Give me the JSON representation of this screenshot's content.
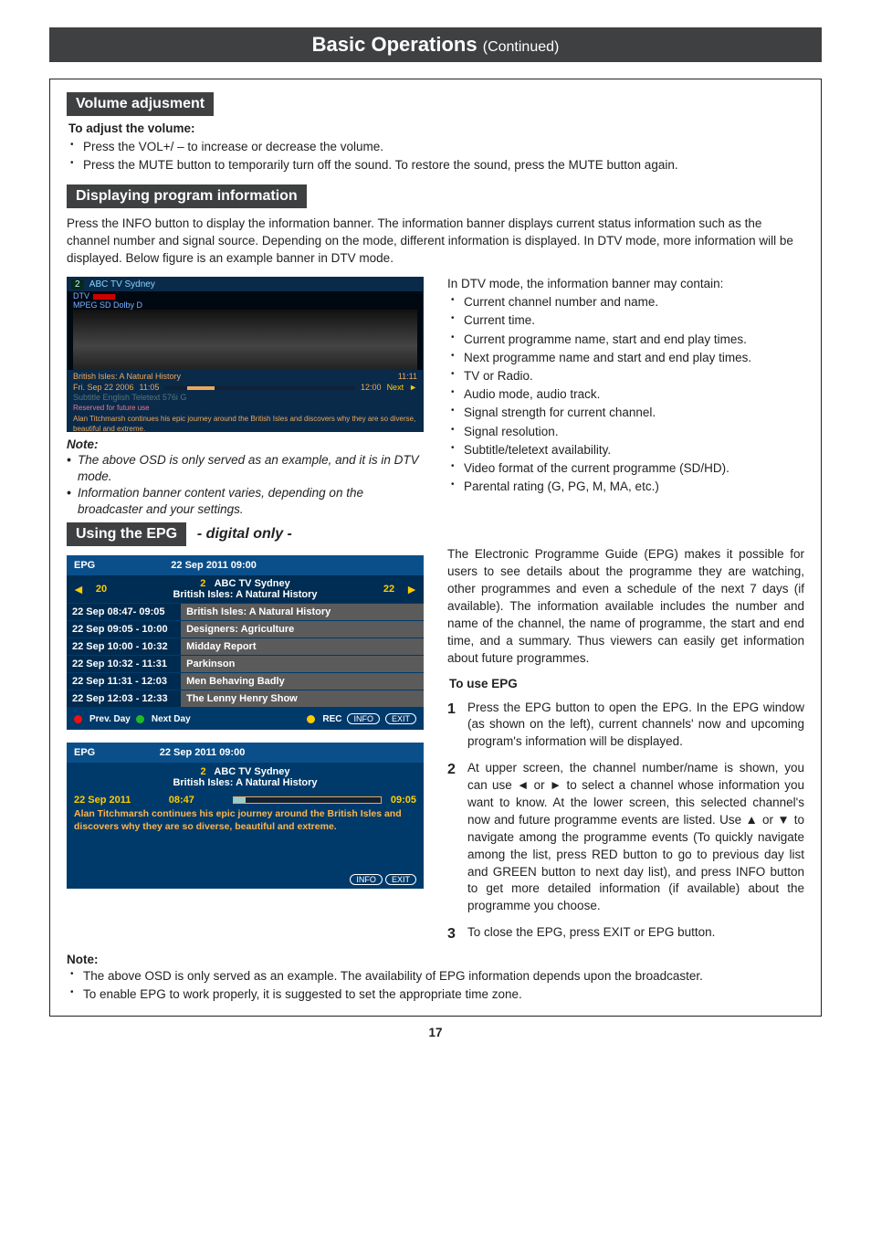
{
  "header": {
    "title": "Basic Operations",
    "sub": "(Continued)"
  },
  "volume": {
    "tag": "Volume adjusment",
    "sub": "To adjust the volume:",
    "b1": "Press the VOL+/ – to increase or decrease the volume.",
    "b2": "Press the MUTE button to temporarily turn off the sound. To restore the sound, press the MUTE button again."
  },
  "display": {
    "tag": "Displaying program information",
    "intro": "Press the INFO button to display the information banner. The information banner displays current status information such as the channel number and signal source.\nDepending on the mode, different information is displayed. In DTV mode, more information will be displayed. Below figure is an example banner in DTV mode.",
    "note_lbl": "Note:",
    "note1": "The above OSD is only served as an example, and it is in DTV mode.",
    "note2": "Information banner content varies, depending on the broadcaster and your settings.",
    "right_intro": "In DTV mode, the information banner may contain:",
    "items": [
      "Current channel number and name.",
      "Current time.",
      "Current programme name, start and end play times.",
      "Next programme name and start and end play times.",
      "TV or Radio.",
      "Audio mode, audio track.",
      "Signal strength for current channel.",
      "Signal resolution.",
      "Subtitle/teletext availability.",
      "Video format of the current programme (SD/HD).",
      "Parental rating (G, PG, M, MA, etc.)"
    ],
    "banner": {
      "ch_no": "2",
      "ch_name": "ABC TV Sydney",
      "tags": "DTV",
      "codec": "MPEG SD Dolby D",
      "prog": "British Isles: A Natural History",
      "date": "Fri. Sep 22 2006",
      "t1": "11:05",
      "t2": "12:00",
      "now": "11:11",
      "next": "Next",
      "meta": "Subtitle   English   Teletext   576i   G",
      "rsv": "Reserved for future use",
      "desc": "Alan Titchmarsh continues his epic journey around the British Isles and discovers why they are so diverse, beautiful and extreme."
    }
  },
  "epg": {
    "tag": "Using the EPG",
    "digital": "- digital only -",
    "head": "EPG",
    "datetime": "22 Sep 2011   09:00",
    "arrow_l": "◄",
    "arrow_r": "►",
    "ch_left": "20",
    "ch_mid_no": "2",
    "ch_mid": "ABC   TV Sydney",
    "ch_prog": "British Isles: A Natural History",
    "ch_right": "22",
    "rows": [
      {
        "t": "22 Sep  08:47- 09:05",
        "p": "British Isles: A Natural History"
      },
      {
        "t": "22 Sep  09:05 - 10:00",
        "p": "Designers: Agriculture"
      },
      {
        "t": "22 Sep  10:00 - 10:32",
        "p": "Midday Report"
      },
      {
        "t": "22 Sep  10:32 - 11:31",
        "p": "Parkinson"
      },
      {
        "t": "22 Sep  11:31 - 12:03",
        "p": "Men Behaving Badly"
      },
      {
        "t": "22 Sep  12:03 - 12:33",
        "p": "The Lenny Henry Show"
      }
    ],
    "prev": "Prev. Day",
    "next": "Next Day",
    "rec": "REC",
    "info": "INFO",
    "exit": "EXIT",
    "detail": {
      "head1": "EPG",
      "head2": "22 Sep 2011   09:00",
      "ch_no": "2",
      "ch": "ABC   TV Sydney",
      "prog": "British Isles: A Natural History",
      "date": "22 Sep 2011",
      "start": "08:47",
      "end": "09:05",
      "desc": "Alan Titchmarsh continues his epic journey around the British Isles and discovers why they are so diverse, beautiful and extreme."
    },
    "right_intro": "The Electronic Programme Guide (EPG) makes it possible for users to see details about the programme they are watching, other programmes and even a schedule of the next 7 days (if available). The information available includes the number and name of the channel, the name of programme, the start and end time, and a summary. Thus viewers can easily get information about future programmes.",
    "touse": "To use EPG",
    "step1": "Press the EPG button to open the EPG. In the EPG window (as shown on the left), current channels' now and upcoming program's information will be displayed.",
    "step2": "At upper screen, the channel number/name is shown, you can use ◄ or ► to select a channel whose information you want to know. At the lower screen, this selected channel's now and future programme events are listed. Use ▲ or ▼ to navigate among the programme events (To quickly navigate among the list, press RED button to go to previous day list and GREEN button to next day list), and press INFO button to get more detailed information (if available) about the programme you choose.",
    "step3": "To close the EPG, press EXIT or EPG button."
  },
  "bottom": {
    "note": "Note:",
    "n1": "The above OSD is only served as an example. The availability of EPG information depends upon the broadcaster.",
    "n2": "To enable EPG to work properly, it is suggested to set the appropriate time zone."
  },
  "page_num": "17"
}
